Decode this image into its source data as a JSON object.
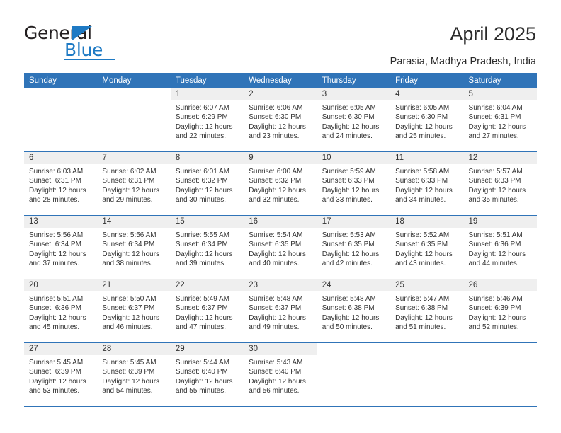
{
  "brand": {
    "word_one": "General",
    "word_two": "Blue",
    "triangle_icon": "brand-triangle-icon",
    "accent_color": "#1e7ac4"
  },
  "header": {
    "title": "April 2025",
    "subtitle": "Parasia, Madhya Pradesh, India"
  },
  "calendar": {
    "header_bg": "#3074b8",
    "daynum_bg": "#efefef",
    "weekdays": [
      "Sunday",
      "Monday",
      "Tuesday",
      "Wednesday",
      "Thursday",
      "Friday",
      "Saturday"
    ],
    "weeks": [
      [
        {
          "day": "",
          "blank": true,
          "lines": []
        },
        {
          "day": "",
          "blank": true,
          "lines": []
        },
        {
          "day": "1",
          "lines": [
            "Sunrise: 6:07 AM",
            "Sunset: 6:29 PM",
            "Daylight: 12 hours",
            "and 22 minutes."
          ]
        },
        {
          "day": "2",
          "lines": [
            "Sunrise: 6:06 AM",
            "Sunset: 6:30 PM",
            "Daylight: 12 hours",
            "and 23 minutes."
          ]
        },
        {
          "day": "3",
          "lines": [
            "Sunrise: 6:05 AM",
            "Sunset: 6:30 PM",
            "Daylight: 12 hours",
            "and 24 minutes."
          ]
        },
        {
          "day": "4",
          "lines": [
            "Sunrise: 6:05 AM",
            "Sunset: 6:30 PM",
            "Daylight: 12 hours",
            "and 25 minutes."
          ]
        },
        {
          "day": "5",
          "lines": [
            "Sunrise: 6:04 AM",
            "Sunset: 6:31 PM",
            "Daylight: 12 hours",
            "and 27 minutes."
          ]
        }
      ],
      [
        {
          "day": "6",
          "lines": [
            "Sunrise: 6:03 AM",
            "Sunset: 6:31 PM",
            "Daylight: 12 hours",
            "and 28 minutes."
          ]
        },
        {
          "day": "7",
          "lines": [
            "Sunrise: 6:02 AM",
            "Sunset: 6:31 PM",
            "Daylight: 12 hours",
            "and 29 minutes."
          ]
        },
        {
          "day": "8",
          "lines": [
            "Sunrise: 6:01 AM",
            "Sunset: 6:32 PM",
            "Daylight: 12 hours",
            "and 30 minutes."
          ]
        },
        {
          "day": "9",
          "lines": [
            "Sunrise: 6:00 AM",
            "Sunset: 6:32 PM",
            "Daylight: 12 hours",
            "and 32 minutes."
          ]
        },
        {
          "day": "10",
          "lines": [
            "Sunrise: 5:59 AM",
            "Sunset: 6:33 PM",
            "Daylight: 12 hours",
            "and 33 minutes."
          ]
        },
        {
          "day": "11",
          "lines": [
            "Sunrise: 5:58 AM",
            "Sunset: 6:33 PM",
            "Daylight: 12 hours",
            "and 34 minutes."
          ]
        },
        {
          "day": "12",
          "lines": [
            "Sunrise: 5:57 AM",
            "Sunset: 6:33 PM",
            "Daylight: 12 hours",
            "and 35 minutes."
          ]
        }
      ],
      [
        {
          "day": "13",
          "lines": [
            "Sunrise: 5:56 AM",
            "Sunset: 6:34 PM",
            "Daylight: 12 hours",
            "and 37 minutes."
          ]
        },
        {
          "day": "14",
          "lines": [
            "Sunrise: 5:56 AM",
            "Sunset: 6:34 PM",
            "Daylight: 12 hours",
            "and 38 minutes."
          ]
        },
        {
          "day": "15",
          "lines": [
            "Sunrise: 5:55 AM",
            "Sunset: 6:34 PM",
            "Daylight: 12 hours",
            "and 39 minutes."
          ]
        },
        {
          "day": "16",
          "lines": [
            "Sunrise: 5:54 AM",
            "Sunset: 6:35 PM",
            "Daylight: 12 hours",
            "and 40 minutes."
          ]
        },
        {
          "day": "17",
          "lines": [
            "Sunrise: 5:53 AM",
            "Sunset: 6:35 PM",
            "Daylight: 12 hours",
            "and 42 minutes."
          ]
        },
        {
          "day": "18",
          "lines": [
            "Sunrise: 5:52 AM",
            "Sunset: 6:35 PM",
            "Daylight: 12 hours",
            "and 43 minutes."
          ]
        },
        {
          "day": "19",
          "lines": [
            "Sunrise: 5:51 AM",
            "Sunset: 6:36 PM",
            "Daylight: 12 hours",
            "and 44 minutes."
          ]
        }
      ],
      [
        {
          "day": "20",
          "lines": [
            "Sunrise: 5:51 AM",
            "Sunset: 6:36 PM",
            "Daylight: 12 hours",
            "and 45 minutes."
          ]
        },
        {
          "day": "21",
          "lines": [
            "Sunrise: 5:50 AM",
            "Sunset: 6:37 PM",
            "Daylight: 12 hours",
            "and 46 minutes."
          ]
        },
        {
          "day": "22",
          "lines": [
            "Sunrise: 5:49 AM",
            "Sunset: 6:37 PM",
            "Daylight: 12 hours",
            "and 47 minutes."
          ]
        },
        {
          "day": "23",
          "lines": [
            "Sunrise: 5:48 AM",
            "Sunset: 6:37 PM",
            "Daylight: 12 hours",
            "and 49 minutes."
          ]
        },
        {
          "day": "24",
          "lines": [
            "Sunrise: 5:48 AM",
            "Sunset: 6:38 PM",
            "Daylight: 12 hours",
            "and 50 minutes."
          ]
        },
        {
          "day": "25",
          "lines": [
            "Sunrise: 5:47 AM",
            "Sunset: 6:38 PM",
            "Daylight: 12 hours",
            "and 51 minutes."
          ]
        },
        {
          "day": "26",
          "lines": [
            "Sunrise: 5:46 AM",
            "Sunset: 6:39 PM",
            "Daylight: 12 hours",
            "and 52 minutes."
          ]
        }
      ],
      [
        {
          "day": "27",
          "lines": [
            "Sunrise: 5:45 AM",
            "Sunset: 6:39 PM",
            "Daylight: 12 hours",
            "and 53 minutes."
          ]
        },
        {
          "day": "28",
          "lines": [
            "Sunrise: 5:45 AM",
            "Sunset: 6:39 PM",
            "Daylight: 12 hours",
            "and 54 minutes."
          ]
        },
        {
          "day": "29",
          "lines": [
            "Sunrise: 5:44 AM",
            "Sunset: 6:40 PM",
            "Daylight: 12 hours",
            "and 55 minutes."
          ]
        },
        {
          "day": "30",
          "lines": [
            "Sunrise: 5:43 AM",
            "Sunset: 6:40 PM",
            "Daylight: 12 hours",
            "and 56 minutes."
          ]
        },
        {
          "day": "",
          "blank": true,
          "lines": []
        },
        {
          "day": "",
          "blank": true,
          "lines": []
        },
        {
          "day": "",
          "blank": true,
          "lines": []
        }
      ]
    ]
  }
}
